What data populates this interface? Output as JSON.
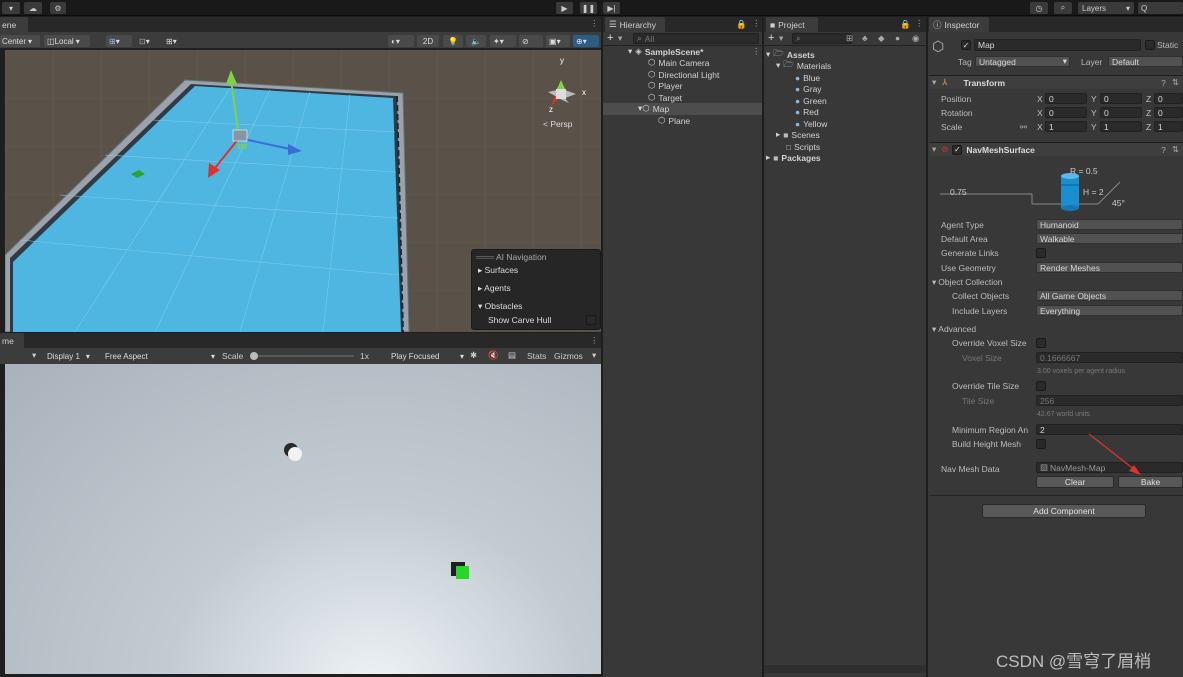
{
  "topbar": {
    "layers_label": "Layers",
    "search_label": "Q"
  },
  "scene": {
    "tab": "ene",
    "pivot": "Center",
    "space": "Local",
    "mode_2d": "2D",
    "gizmo_axes": {
      "y": "y",
      "x": "x",
      "z": "z"
    },
    "persp": "< Persp",
    "overlay": {
      "title": "AI Navigation",
      "items": [
        "Surfaces",
        "Agents",
        "Obstacles"
      ],
      "show_carve_hull": "Show Carve Hull"
    }
  },
  "game": {
    "tab": "me",
    "display": "Display 1",
    "aspect": "Free Aspect",
    "scale_label": "Scale",
    "scale_value": "1x",
    "play_focused": "Play Focused",
    "stats": "Stats",
    "gizmos": "Gizmos"
  },
  "hierarchy": {
    "tab": "Hierarchy",
    "search_placeholder": "All",
    "scene_name": "SampleScene*",
    "items": [
      "Main Camera",
      "Directional Light",
      "Player",
      "Target",
      "Map"
    ],
    "child": "Plane"
  },
  "project": {
    "tab": "Project",
    "assets": "Assets",
    "materials": "Materials",
    "material_items": [
      "Blue",
      "Gray",
      "Green",
      "Red",
      "Yellow"
    ],
    "scenes": "Scenes",
    "scripts": "Scripts",
    "packages": "Packages"
  },
  "inspector": {
    "tab": "Inspector",
    "object_name": "Map",
    "static_label": "Static",
    "tag_label": "Tag",
    "tag_value": "Untagged",
    "layer_label": "Layer",
    "layer_value": "Default",
    "transform": {
      "title": "Transform",
      "rows": [
        {
          "label": "Position",
          "x": "0",
          "y": "0",
          "z": "0"
        },
        {
          "label": "Rotation",
          "x": "0",
          "y": "0",
          "z": "0"
        },
        {
          "label": "Scale",
          "x": "1",
          "y": "1",
          "z": "1"
        }
      ]
    },
    "navmesh": {
      "title": "NavMeshSurface",
      "diagram": {
        "radius": "R = 0.5",
        "step": "0.75",
        "height": "H = 2",
        "slope": "45°"
      },
      "agent_type_label": "Agent Type",
      "agent_type": "Humanoid",
      "default_area_label": "Default Area",
      "default_area": "Walkable",
      "generate_links": "Generate Links",
      "use_geometry_label": "Use Geometry",
      "use_geometry": "Render Meshes",
      "object_collection": "Object Collection",
      "collect_objects_label": "Collect Objects",
      "collect_objects": "All Game Objects",
      "include_layers_label": "Include Layers",
      "include_layers": "Everything",
      "advanced": "Advanced",
      "override_voxel": "Override Voxel Size",
      "voxel_size_label": "Voxel Size",
      "voxel_size": "0.1666667",
      "voxel_hint": "3.00 voxels per agent radius",
      "override_tile": "Override Tile Size",
      "tile_size_label": "Tile Size",
      "tile_size": "256",
      "tile_hint": "42.67 world units",
      "min_region_label": "Minimum Region An",
      "min_region": "2",
      "build_height_mesh": "Build Height Mesh",
      "nav_mesh_data_label": "Nav Mesh Data",
      "nav_mesh_data": "NavMesh-Map",
      "clear": "Clear",
      "bake": "Bake"
    },
    "add_component": "Add Component"
  },
  "watermark": "CSDN @雪穹了眉梢",
  "colors": {
    "panel_bg": "#383838",
    "plane": "#4fb6e2",
    "accent_blue": "#2c5d87",
    "arrow": "#e0322c"
  }
}
